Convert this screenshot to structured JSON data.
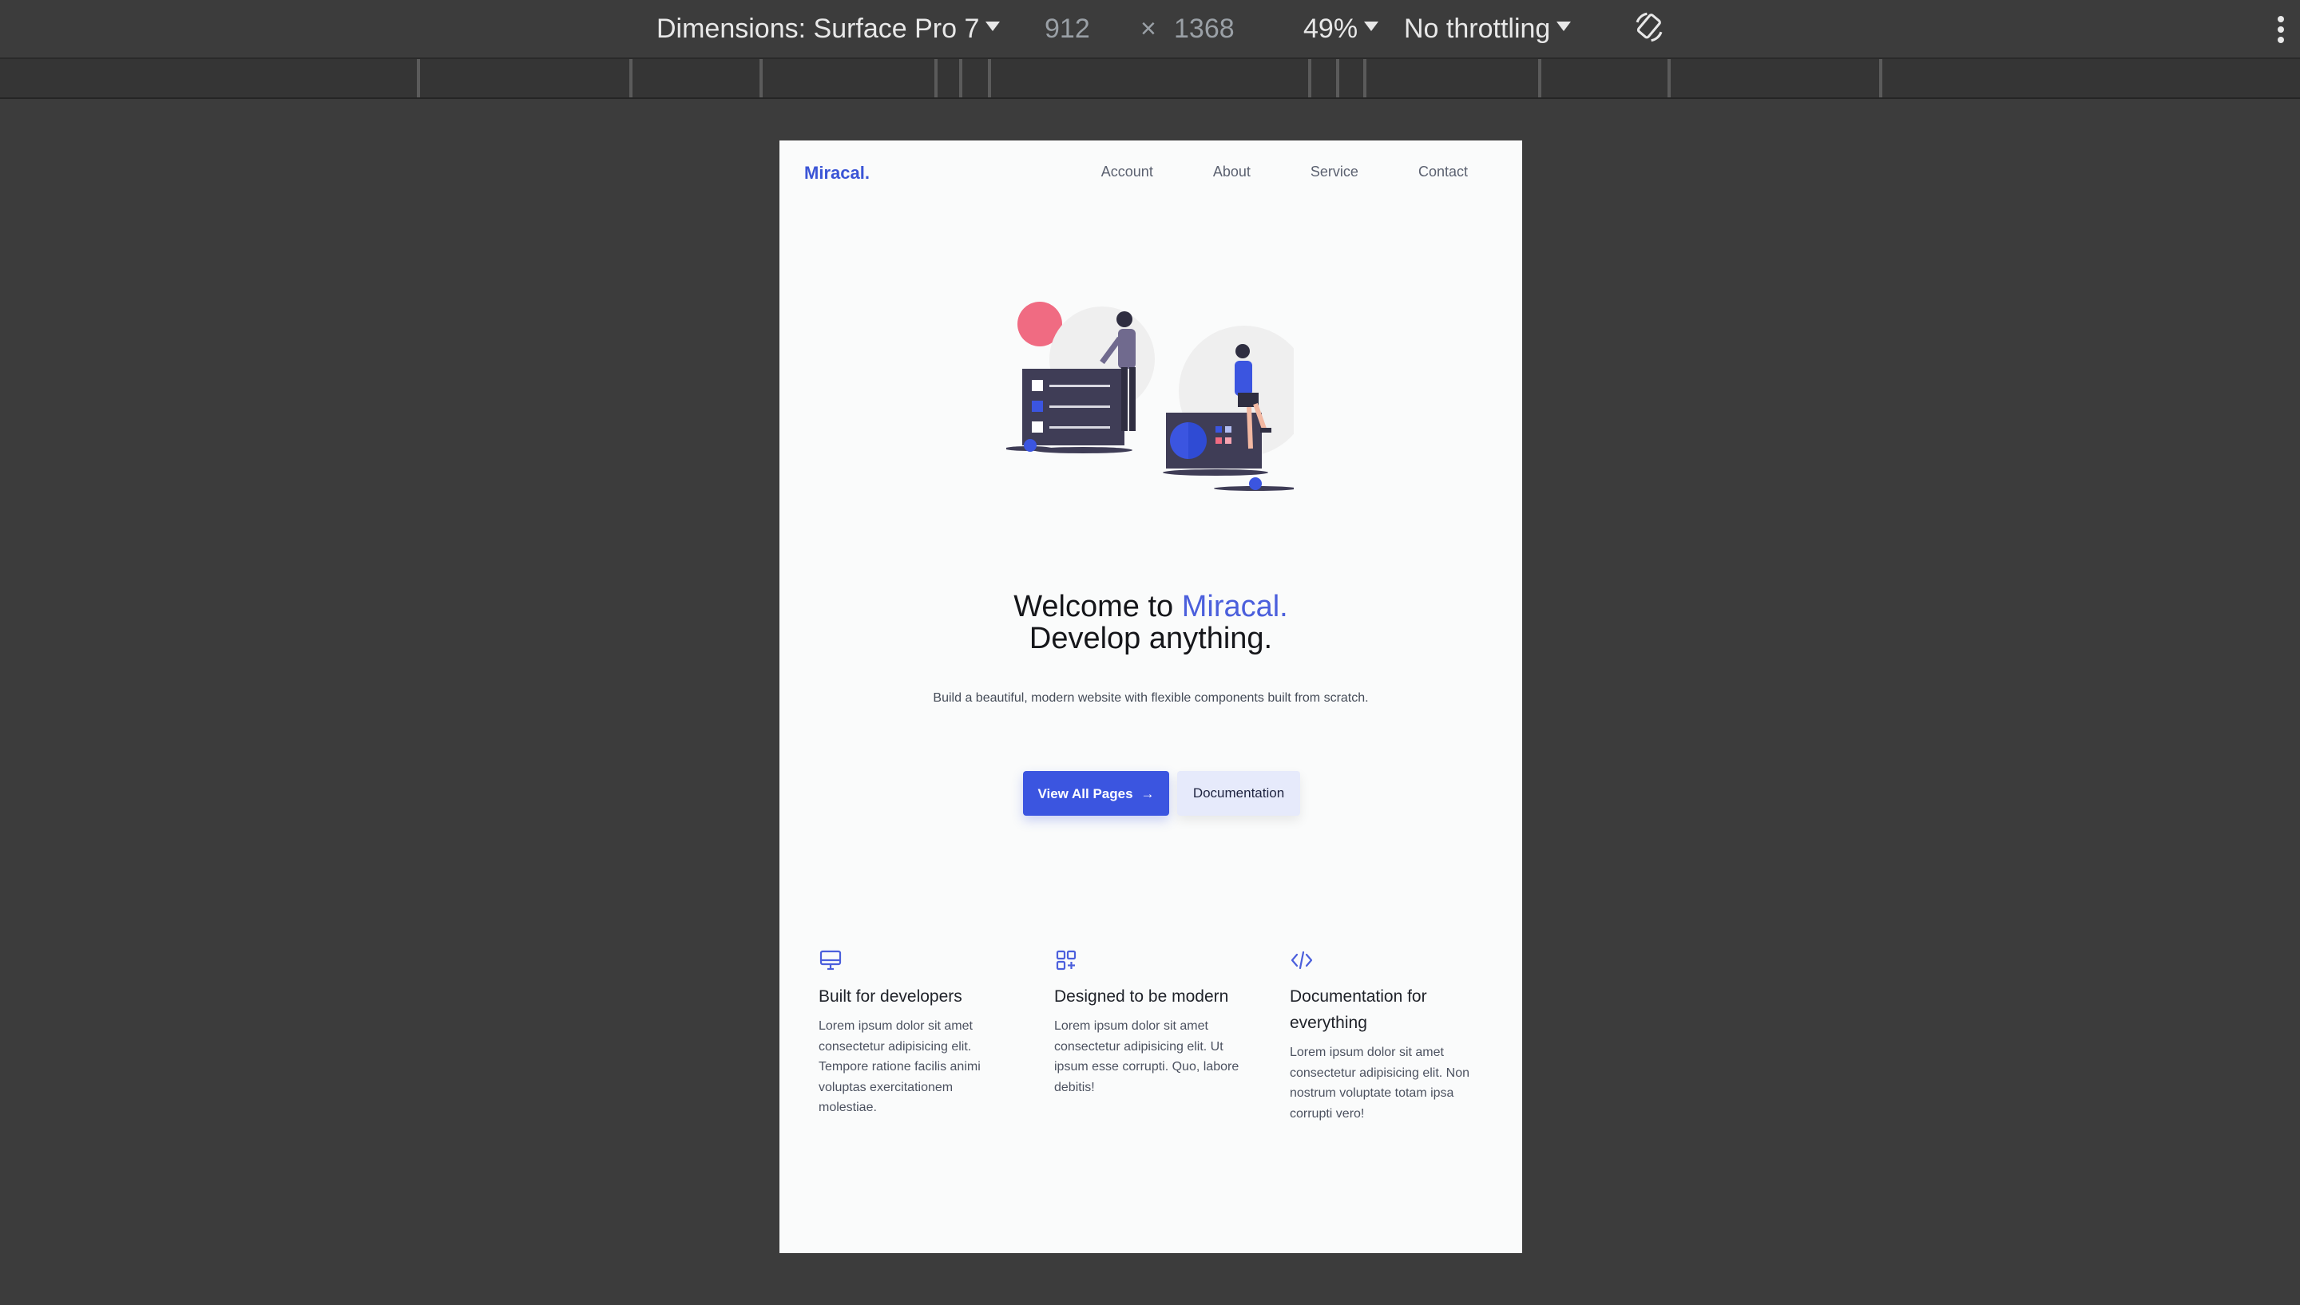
{
  "devtools": {
    "device_label": "Dimensions: Surface Pro 7",
    "width": "912",
    "times": "×",
    "height": "1368",
    "zoom": "49%",
    "throttling": "No throttling",
    "rotate_icon": "rotate-icon",
    "menu_icon": "more-vert-icon"
  },
  "site": {
    "logo": "Miracal.",
    "nav": [
      "Account",
      "About",
      "Service",
      "Contact"
    ],
    "headline_prefix": "Welcome to ",
    "headline_accent": "Miracal.",
    "headline_line2": "Develop anything.",
    "subtitle": "Build a beautiful, modern website with flexible components built from scratch.",
    "primary_button": "View All Pages",
    "primary_button_icon": "→",
    "secondary_button": "Documentation",
    "features": [
      {
        "icon": "monitor-icon",
        "title": "Built for developers",
        "text": "Lorem ipsum dolor sit amet consectetur adipisicing elit. Tempore ratione facilis animi voluptas exercitationem molestiae."
      },
      {
        "icon": "grid-plus-icon",
        "title": "Designed to be modern",
        "text": "Lorem ipsum dolor sit amet consectetur adipisicing elit. Ut ipsum esse corrupti. Quo, labore debitis!"
      },
      {
        "icon": "code-icon",
        "title": "Documentation for everything",
        "text": "Lorem ipsum dolor sit amet consectetur adipisicing elit. Non nostrum voluptate totam ipsa corrupti vero!"
      }
    ]
  },
  "colors": {
    "accent": "#3b55e0",
    "accent_text": "#4b5fdc",
    "secondary_bg": "#e6eafb",
    "illustration_pink": "#f06b82",
    "illustration_dark": "#3f3d56"
  }
}
